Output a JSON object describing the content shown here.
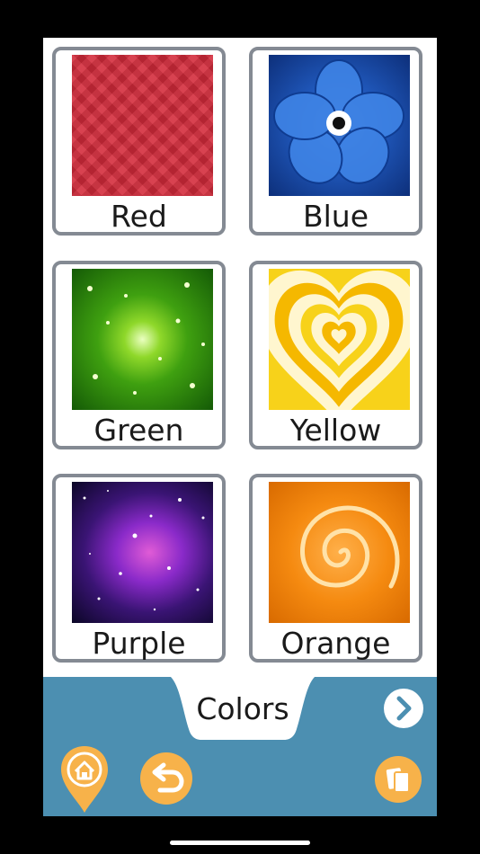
{
  "tiles": [
    {
      "label": "Red",
      "image": "red-texture-image"
    },
    {
      "label": "Blue",
      "image": "blue-flower-image"
    },
    {
      "label": "Green",
      "image": "green-sparkle-image"
    },
    {
      "label": "Yellow",
      "image": "yellow-hearts-image"
    },
    {
      "label": "Purple",
      "image": "purple-galaxy-image"
    },
    {
      "label": "Orange",
      "image": "orange-spiral-image"
    }
  ],
  "footer": {
    "category_title": "Colors",
    "icons": [
      "chevron-right-icon",
      "home-icon",
      "undo-icon",
      "cards-icon"
    ]
  },
  "colors": {
    "footer_bg": "#4c8fb1",
    "card_border": "#848a93",
    "button_orange": "#f7b24a"
  }
}
